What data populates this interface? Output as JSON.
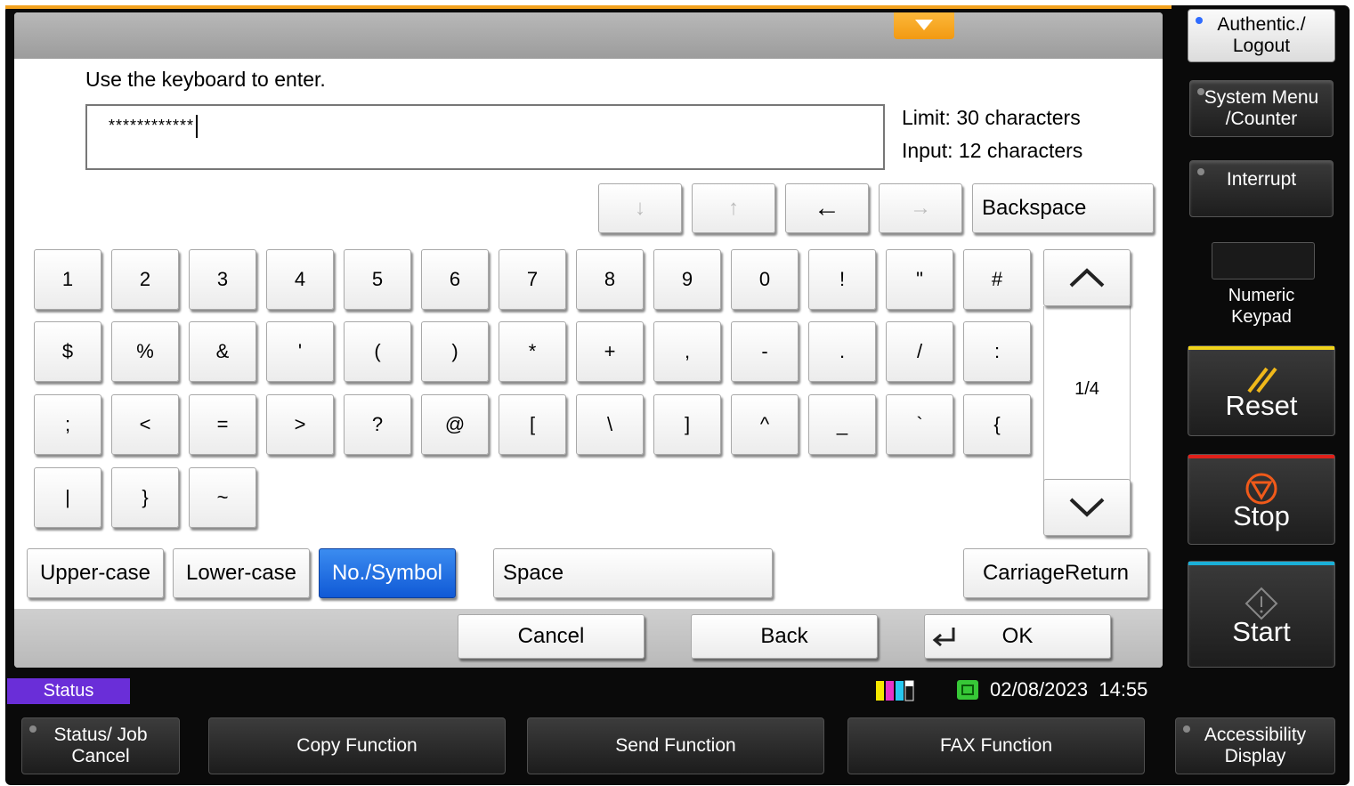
{
  "screen": {
    "instruction": "Use the keyboard to enter.",
    "input_value": "************",
    "limit_text": "Limit: 30 characters",
    "input_count_text": "Input: 12 characters"
  },
  "cursor_keys": {
    "down": "↓",
    "up": "↑",
    "left": "←",
    "right": "→",
    "backspace": "Backspace"
  },
  "keyboard": {
    "rows": [
      [
        "1",
        "2",
        "3",
        "4",
        "5",
        "6",
        "7",
        "8",
        "9",
        "0",
        "!",
        "\"",
        "#"
      ],
      [
        "$",
        "%",
        "&",
        "'",
        "(",
        ")",
        "*",
        "+",
        ",",
        "-",
        ".",
        "/",
        ":"
      ],
      [
        ";",
        "<",
        "=",
        ">",
        "?",
        "@",
        "[",
        "\\",
        "]",
        "^",
        "_",
        "`",
        "{"
      ],
      [
        "|",
        "}",
        "~"
      ]
    ],
    "page": "1/4",
    "modes": {
      "upper": "Upper-case",
      "lower": "Lower-case",
      "symbol": "No./Symbol"
    },
    "space": "Space",
    "carriage_return": "CarriageReturn"
  },
  "actions": {
    "cancel": "Cancel",
    "back": "Back",
    "ok": "OK"
  },
  "status_bar": {
    "status_tab": "Status",
    "date": "02/08/2023",
    "time": "14:55"
  },
  "hard_keys": {
    "authentic": "Authentic./ Logout",
    "system_menu": "System Menu /Counter",
    "interrupt": "Interrupt",
    "numeric_keypad": "Numeric Keypad",
    "reset": "Reset",
    "stop": "Stop",
    "start": "Start",
    "accessibility": "Accessibility Display"
  },
  "function_keys": {
    "status_job_cancel": "Status/ Job Cancel",
    "copy": "Copy Function",
    "send": "Send Function",
    "fax": "FAX Function"
  },
  "colors": {
    "selected_mode": "#1a6be0",
    "reset_bar": "#f0d31a",
    "stop_bar": "#e0201a",
    "start_bar": "#1ab0d8",
    "status_tab": "#6a2ed8",
    "accent_orange": "#f3a21f"
  }
}
